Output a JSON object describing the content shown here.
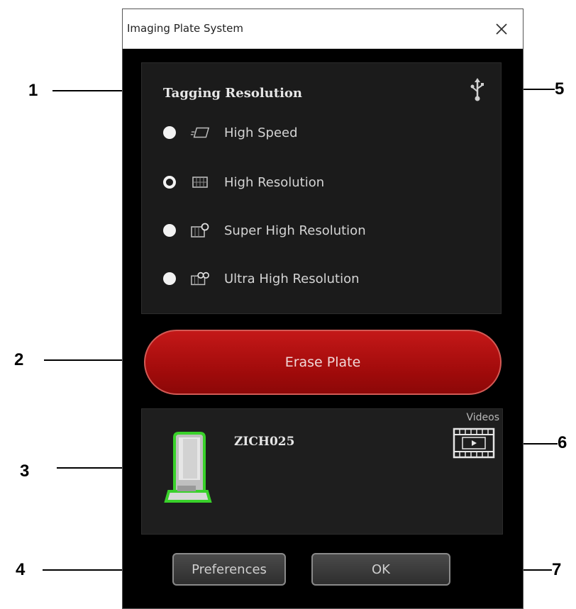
{
  "callouts": [
    "1",
    "2",
    "3",
    "4",
    "5",
    "6",
    "7"
  ],
  "window": {
    "title": "Imaging Plate System"
  },
  "tagging": {
    "title": "Tagging Resolution",
    "options": [
      {
        "label": "High Speed",
        "icon": "high-speed-icon",
        "selected": false
      },
      {
        "label": "High Resolution",
        "icon": "high-resolution-icon",
        "selected": true
      },
      {
        "label": "Super High Resolution",
        "icon": "super-high-resolution-icon",
        "selected": false
      },
      {
        "label": "Ultra High Resolution",
        "icon": "ultra-high-resolution-icon",
        "selected": false
      }
    ]
  },
  "erase": {
    "label": "Erase Plate"
  },
  "device": {
    "name": "ZICH025",
    "videos_label": "Videos"
  },
  "buttons": {
    "preferences": "Preferences",
    "ok": "OK"
  },
  "colors": {
    "erase_red": "#b01010",
    "device_glow": "#39d12a",
    "panel_bg": "#1b1b1b"
  }
}
